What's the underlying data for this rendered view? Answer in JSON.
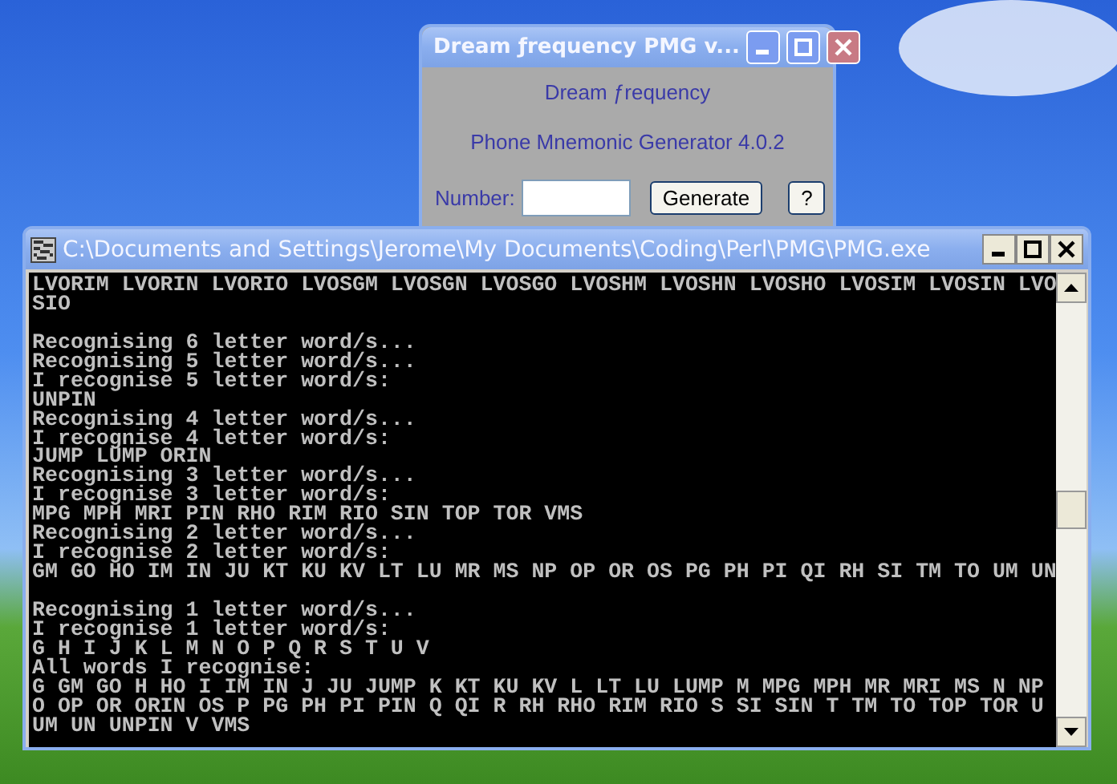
{
  "app_window": {
    "title": "Dream ƒrequency PMG v...",
    "heading": "Dream ƒrequency",
    "subtitle": "Phone Mnemonic Generator 4.0.2",
    "number_label": "Number:",
    "buttons": [
      "Generate",
      "?"
    ]
  },
  "console_window": {
    "title": "C:\\Documents and Settings\\Jerome\\My Documents\\Coding\\Perl\\PMG\\PMG.exe",
    "blocks": [
      [
        "LVORIM LVORIN LVORIO LVOSGM LVOSGN LVOSGO LVOSHM LVOSHN LVOSHO LVOSIM LVOSIN LVO",
        "SIO"
      ],
      [
        "Recognising 6 letter word/s...",
        "Recognising 5 letter word/s...",
        "I recognise 5 letter word/s:",
        "UNPIN",
        "Recognising 4 letter word/s...",
        "I recognise 4 letter word/s:",
        "JUMP LUMP ORIN",
        "Recognising 3 letter word/s...",
        "I recognise 3 letter word/s:",
        "MPG MPH MRI PIN RHO RIM RIO SIN TOP TOR VMS",
        "Recognising 2 letter word/s...",
        "I recognise 2 letter word/s:",
        "GM GO HO IM IN JU KT KU KV LT LU MR MS NP OP OR OS PG PH PI QI RH SI TM TO UM UN"
      ],
      [
        "Recognising 1 letter word/s...",
        "I recognise 1 letter word/s:",
        "G H I J K L M N O P Q R S T U V",
        "All words I recognise:",
        "G GM GO H HO I IM IN J JU JUMP K KT KU KV L LT LU LUMP M MPG MPH MR MRI MS N NP",
        "O OP OR ORIN OS P PG PH PI PIN Q QI R RH RHO RIM RIO S SI SIN T TM TO TOP TOR U",
        "UM UN UNPIN V VMS"
      ]
    ]
  }
}
